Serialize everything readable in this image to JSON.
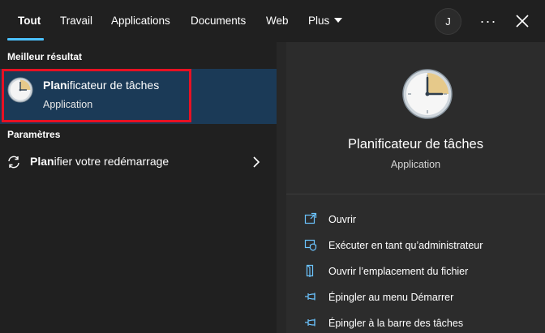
{
  "tabs": [
    {
      "label": "Tout",
      "active": true
    },
    {
      "label": "Travail"
    },
    {
      "label": "Applications"
    },
    {
      "label": "Documents"
    },
    {
      "label": "Web"
    },
    {
      "label": "Plus"
    }
  ],
  "header": {
    "avatar_initial": "J",
    "more_label": "···",
    "more_icon": "more-icon",
    "close_icon": "close-icon"
  },
  "results": {
    "best_match_heading": "Meilleur résultat",
    "best_match": {
      "title_match": "Plan",
      "title_rest": "ificateur de tâches",
      "type": "Application",
      "icon": "clock-icon"
    },
    "settings_heading": "Paramètres",
    "settings_item": {
      "label_match": "Plan",
      "label_rest": "ifier votre redémarrage",
      "icon": "refresh-icon",
      "chevron_icon": "chevron-right-icon"
    }
  },
  "details": {
    "title": "Planificateur de tâches",
    "subtitle": "Application",
    "icon": "clock-icon",
    "actions": [
      {
        "label": "Ouvrir",
        "icon": "open-icon"
      },
      {
        "label": "Exécuter en tant qu’administrateur",
        "icon": "shield-icon"
      },
      {
        "label": "Ouvrir l’emplacement du fichier",
        "icon": "file-location-icon"
      },
      {
        "label": "Épingler au menu Démarrer",
        "icon": "pin-icon"
      },
      {
        "label": "Épingler à la barre des tâches",
        "icon": "pin-icon"
      }
    ]
  },
  "colors": {
    "accent": "#4cc2ff",
    "highlight_outline": "#e81123",
    "selected_bg": "#1b3a57",
    "background": "#202020"
  }
}
